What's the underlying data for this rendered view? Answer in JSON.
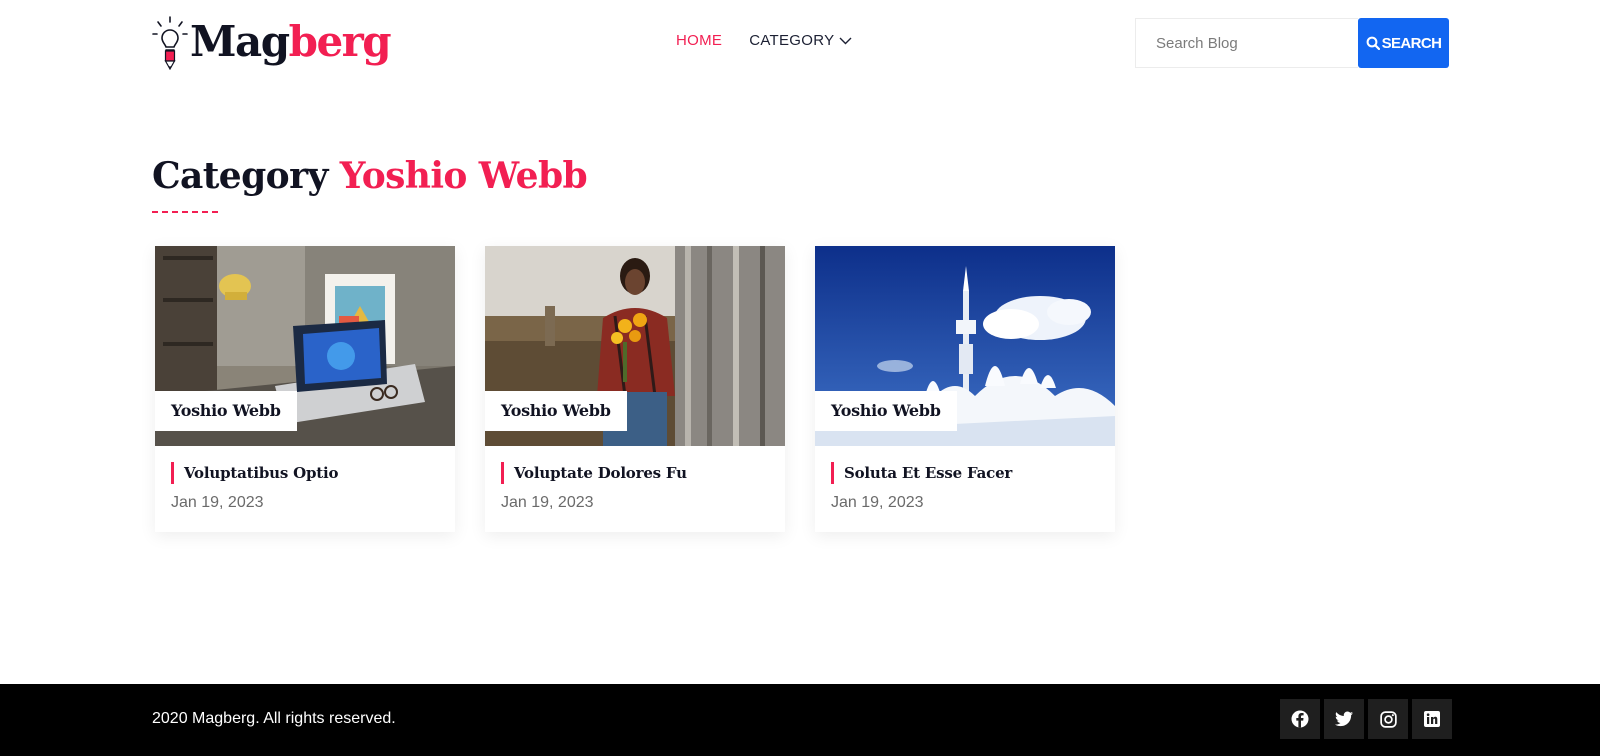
{
  "header": {
    "logo": {
      "part1": "Mag",
      "part2": "berg"
    },
    "nav": {
      "home": "HOME",
      "category": "CATEGORY"
    },
    "search": {
      "placeholder": "Search Blog",
      "button": "SEARCH"
    }
  },
  "page": {
    "heading_prefix": "Category",
    "heading_name": "Yoshio Webb"
  },
  "cards": [
    {
      "tag": "Yoshio Webb",
      "title": "Voluptatibus Optio",
      "date": "Jan 19, 2023",
      "image": "laptop-desk-photo"
    },
    {
      "tag": "Yoshio Webb",
      "title": "Voluptate Dolores Fu",
      "date": "Jan 19, 2023",
      "image": "woman-sunflowers-photo"
    },
    {
      "tag": "Yoshio Webb",
      "title": "Soluta Et Esse Facer",
      "date": "Jan 19, 2023",
      "image": "snowy-tower-photo"
    }
  ],
  "footer": {
    "copyright": "2020 Magberg. All rights reserved.",
    "socials": [
      "facebook-icon",
      "twitter-icon",
      "instagram-icon",
      "linkedin-icon"
    ]
  },
  "colors": {
    "accent": "#f21f52",
    "primary_button": "#1266f1",
    "dark_text": "#111322",
    "footer_bg": "#000000"
  }
}
